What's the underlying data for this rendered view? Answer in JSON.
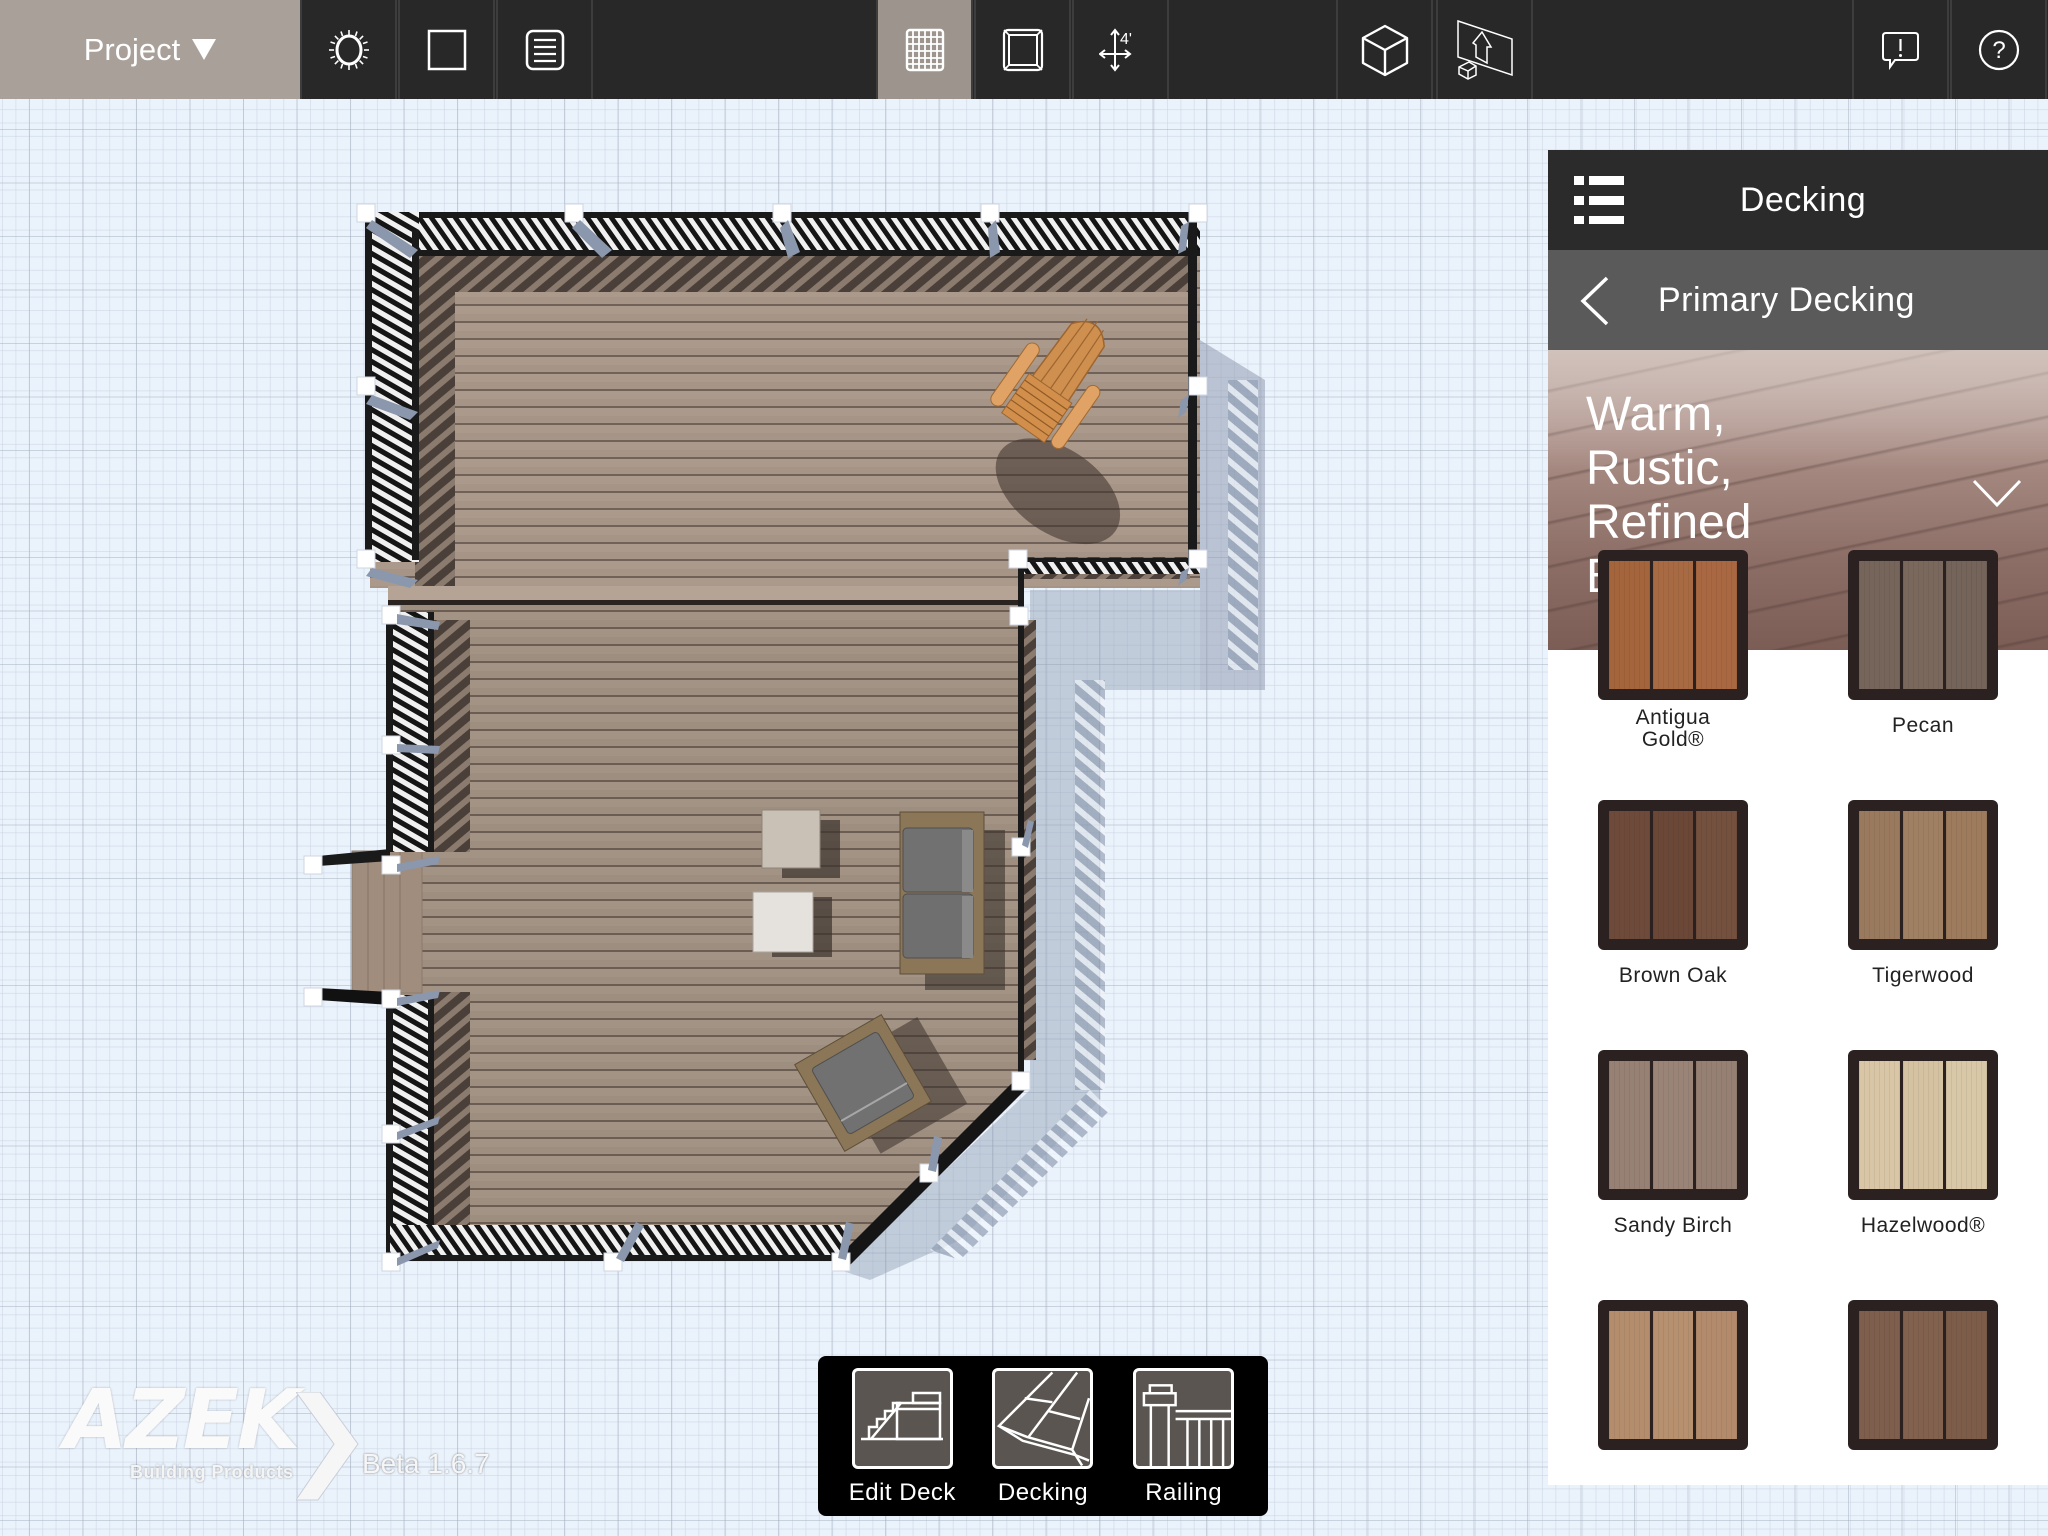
{
  "toolbar": {
    "project_label": "Project",
    "buttons": [
      {
        "id": "sun",
        "icon": "sun-icon"
      },
      {
        "id": "page",
        "icon": "page-icon"
      },
      {
        "id": "list",
        "icon": "document-list-icon"
      },
      {
        "id": "grid",
        "icon": "grid-icon",
        "active": true
      },
      {
        "id": "frame",
        "icon": "frame-view-icon"
      },
      {
        "id": "measure",
        "icon": "measure-icon",
        "text": "4'"
      },
      {
        "id": "view3d",
        "icon": "cube-3d-icon"
      },
      {
        "id": "house",
        "icon": "house-placement-icon"
      },
      {
        "id": "feedback",
        "icon": "feedback-icon"
      },
      {
        "id": "help",
        "icon": "help-icon"
      }
    ]
  },
  "panel": {
    "header_title": "Decking",
    "subheader_title": "Primary Decking",
    "category_title": "Warm, Rustic, Refined Browns",
    "category_lines": [
      "Warm,",
      "Rustic,",
      "Refined",
      "Browns"
    ],
    "swatches": [
      {
        "name": "Antigua Gold®",
        "name_lines": [
          "Antigua",
          "Gold®"
        ],
        "colors": [
          "#a5653c",
          "#a86a42",
          "#a96841"
        ]
      },
      {
        "name": "Pecan",
        "name_lines": [
          "Pecan"
        ],
        "colors": [
          "#76655a",
          "#7a685d",
          "#74645a"
        ]
      },
      {
        "name": "Brown Oak",
        "name_lines": [
          "Brown Oak"
        ],
        "colors": [
          "#6e4a3b",
          "#6b4738",
          "#74503f"
        ]
      },
      {
        "name": "Tigerwood",
        "name_lines": [
          "Tigerwood"
        ],
        "colors": [
          "#9a7a5e",
          "#a08062",
          "#9d7b5c"
        ]
      },
      {
        "name": "Sandy Birch",
        "name_lines": [
          "Sandy Birch"
        ],
        "colors": [
          "#978174",
          "#9a8477",
          "#968073"
        ]
      },
      {
        "name": "Hazelwood®",
        "name_lines": [
          "Hazelwood®"
        ],
        "colors": [
          "#d8c6a6",
          "#d4c2a1",
          "#d9c8a8"
        ]
      },
      {
        "name": "",
        "name_lines": [],
        "colors": [
          "#b48d6d",
          "#b79070",
          "#b38b6c"
        ]
      },
      {
        "name": "",
        "name_lines": [],
        "colors": [
          "#7e5e4c",
          "#82614e",
          "#7d5d4a"
        ]
      }
    ]
  },
  "dock": {
    "items": [
      {
        "label": "Edit Deck",
        "icon": "edit-deck-icon"
      },
      {
        "label": "Decking",
        "icon": "decking-icon"
      },
      {
        "label": "Railing",
        "icon": "railing-icon"
      }
    ]
  },
  "logo": {
    "brand": "AZEK",
    "tagline": "Building Products",
    "version": "Beta 1.6.7"
  },
  "scene": {
    "deck_color": "#a69586",
    "railing_color": "#1a1a1a",
    "post_color": "#ffffff",
    "furniture": [
      "adirondack-chair",
      "ottoman",
      "side-table",
      "loveseat",
      "lounge-chair"
    ]
  }
}
